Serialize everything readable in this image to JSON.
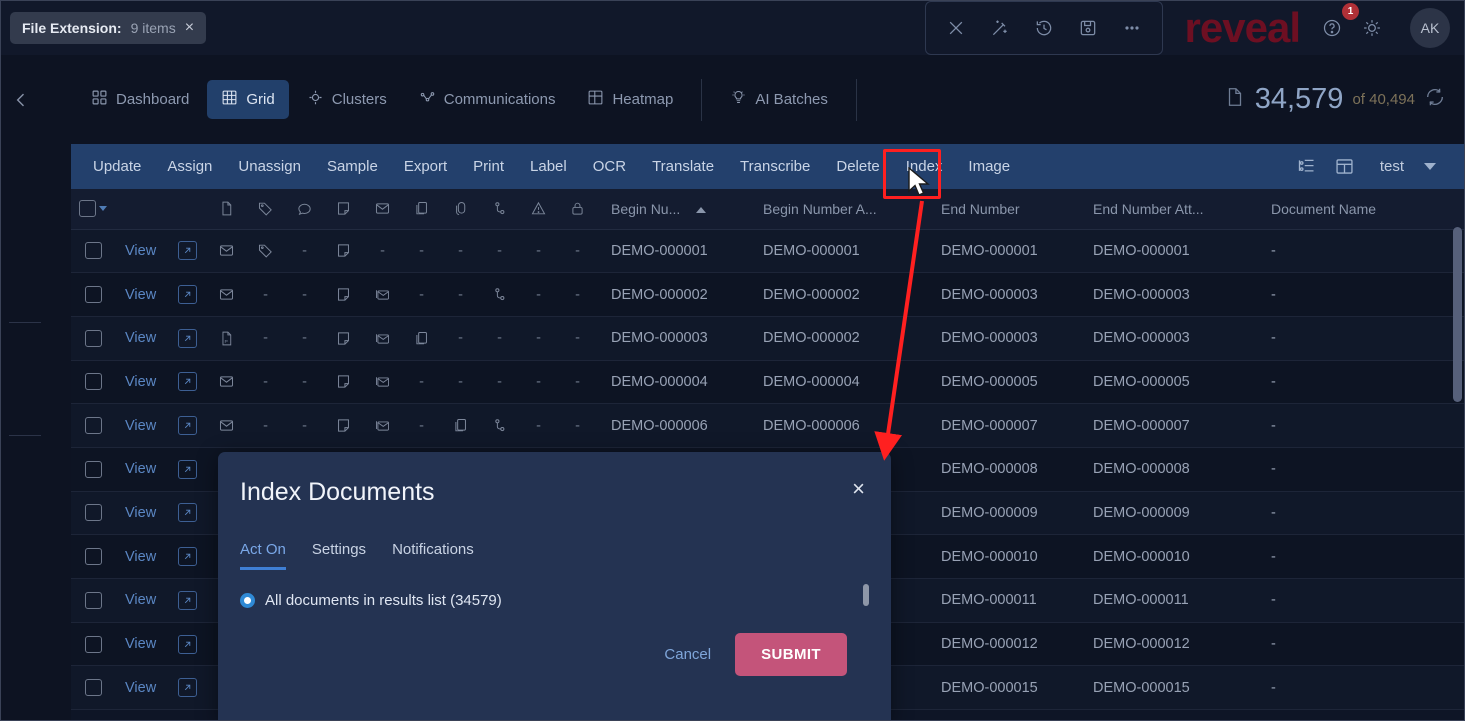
{
  "topbar": {
    "filter_chip": {
      "key": "File Extension:",
      "value": "9 items",
      "close": "×"
    },
    "icons": [
      {
        "name": "close-icon",
        "label": "Close"
      },
      {
        "name": "magic-wand-icon",
        "label": "Magic"
      },
      {
        "name": "history-icon",
        "label": "History"
      },
      {
        "name": "save-icon",
        "label": "Save"
      },
      {
        "name": "more-options-icon",
        "label": "More"
      }
    ],
    "brand": "reveal",
    "help_badge": "1",
    "avatar_initials": "AK"
  },
  "nav": {
    "collapse_chevron": "‹",
    "tabs": [
      {
        "label": "Dashboard",
        "icon": "dashboard-icon",
        "active": false
      },
      {
        "label": "Grid",
        "icon": "grid-icon",
        "active": true
      },
      {
        "label": "Clusters",
        "icon": "clusters-icon",
        "active": false
      },
      {
        "label": "Communications",
        "icon": "communications-icon",
        "active": false
      },
      {
        "label": "Heatmap",
        "icon": "heatmap-icon",
        "active": false
      },
      {
        "label": "AI Batches",
        "icon": "ai-batches-icon",
        "active": false
      }
    ],
    "doc_count": "34,579",
    "doc_total": "of 40,494"
  },
  "actionbar": {
    "actions": [
      "Update",
      "Assign",
      "Unassign",
      "Sample",
      "Export",
      "Print",
      "Label",
      "OCR",
      "Translate",
      "Transcribe",
      "Delete",
      "Index",
      "Image"
    ],
    "highlighted_action": "Index",
    "view_select": "test"
  },
  "grid": {
    "icon_columns": [
      "document-icon",
      "tag-icon",
      "comment-icon",
      "note-icon",
      "envelope-icon",
      "copy-icon",
      "attachment-icon",
      "branch-icon",
      "warning-icon",
      "lock-icon"
    ],
    "columns": [
      "Begin Nu...",
      "Begin Number A...",
      "End Number",
      "End Number Att...",
      "Document Name"
    ],
    "sort_column": "Begin Nu...",
    "sort_direction": "asc",
    "view_label": "View",
    "rows": [
      {
        "icons": [
          "envelope",
          "tag",
          "-",
          "note",
          "-",
          "-",
          "-",
          "-",
          "-",
          "-"
        ],
        "begin": "DEMO-000001",
        "begin_att": "DEMO-000001",
        "end": "DEMO-000001",
        "end_att": "DEMO-000001",
        "docname": "-"
      },
      {
        "icons": [
          "envelope",
          "-",
          "-",
          "note",
          "envelope-stack",
          "-",
          "-",
          "branch",
          "-",
          "-"
        ],
        "begin": "DEMO-000002",
        "begin_att": "DEMO-000002",
        "end": "DEMO-000003",
        "end_att": "DEMO-000003",
        "docname": "-"
      },
      {
        "icons": [
          "pdf",
          "-",
          "-",
          "note",
          "envelope-stack",
          "copy",
          "-",
          "-",
          "-",
          "-"
        ],
        "begin": "DEMO-000003",
        "begin_att": "DEMO-000002",
        "end": "DEMO-000003",
        "end_att": "DEMO-000003",
        "docname": "-"
      },
      {
        "icons": [
          "envelope",
          "-",
          "-",
          "note",
          "envelope-stack",
          "-",
          "-",
          "-",
          "-",
          "-"
        ],
        "begin": "DEMO-000004",
        "begin_att": "DEMO-000004",
        "end": "DEMO-000005",
        "end_att": "DEMO-000005",
        "docname": "-"
      },
      {
        "icons": [
          "envelope",
          "-",
          "-",
          "note",
          "envelope-stack",
          "-",
          "copy",
          "branch",
          "-",
          "-"
        ],
        "begin": "DEMO-000006",
        "begin_att": "DEMO-000006",
        "end": "DEMO-000007",
        "end_att": "DEMO-000007",
        "docname": "-"
      },
      {
        "icons": [
          "-",
          "-",
          "-",
          "-",
          "-",
          "-",
          "-",
          "-",
          "-",
          "-"
        ],
        "begin": "",
        "begin_att": "",
        "end": "DEMO-000008",
        "end_att": "DEMO-000008",
        "docname": "-"
      },
      {
        "icons": [
          "-",
          "-",
          "-",
          "-",
          "-",
          "-",
          "-",
          "-",
          "-",
          "-"
        ],
        "begin": "",
        "begin_att": "",
        "end": "DEMO-000009",
        "end_att": "DEMO-000009",
        "docname": "-"
      },
      {
        "icons": [
          "-",
          "-",
          "-",
          "-",
          "-",
          "-",
          "-",
          "-",
          "-",
          "-"
        ],
        "begin": "",
        "begin_att": "",
        "end": "DEMO-000010",
        "end_att": "DEMO-000010",
        "docname": "-"
      },
      {
        "icons": [
          "-",
          "-",
          "-",
          "-",
          "-",
          "-",
          "-",
          "-",
          "-",
          "-"
        ],
        "begin": "",
        "begin_att": "",
        "end": "DEMO-000011",
        "end_att": "DEMO-000011",
        "docname": "-"
      },
      {
        "icons": [
          "-",
          "-",
          "-",
          "-",
          "-",
          "-",
          "-",
          "-",
          "-",
          "-"
        ],
        "begin": "",
        "begin_att": "",
        "end": "DEMO-000012",
        "end_att": "DEMO-000012",
        "docname": "-"
      },
      {
        "icons": [
          "-",
          "-",
          "-",
          "-",
          "-",
          "-",
          "-",
          "-",
          "-",
          "-"
        ],
        "begin": "",
        "begin_att": "",
        "end": "DEMO-000015",
        "end_att": "DEMO-000015",
        "docname": "-"
      }
    ]
  },
  "modal": {
    "title": "Index Documents",
    "close": "×",
    "tabs": [
      {
        "label": "Act On",
        "active": true
      },
      {
        "label": "Settings",
        "active": false
      },
      {
        "label": "Notifications",
        "active": false
      }
    ],
    "radio_label": "All documents in results list (34579)",
    "cancel_label": "Cancel",
    "submit_label": "SUBMIT"
  },
  "colors": {
    "accent_blue": "#23406c",
    "submit_pink": "#c4547a",
    "brand_red": "#6d0f22",
    "annotation_red": "#ff2020",
    "modal_bg": "#243352",
    "page_bg": "#0d1322"
  }
}
